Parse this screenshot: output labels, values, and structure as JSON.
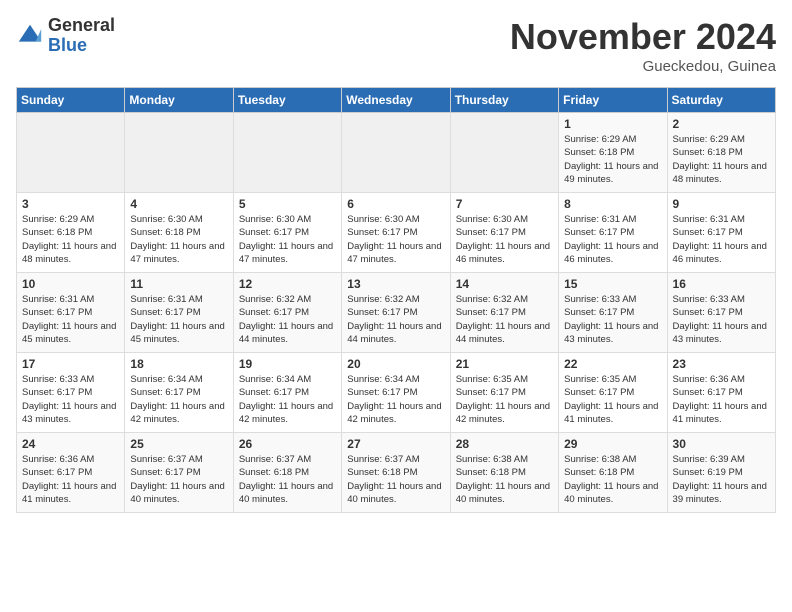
{
  "header": {
    "logo_general": "General",
    "logo_blue": "Blue",
    "month_title": "November 2024",
    "location": "Gueckedou, Guinea"
  },
  "days_of_week": [
    "Sunday",
    "Monday",
    "Tuesday",
    "Wednesday",
    "Thursday",
    "Friday",
    "Saturday"
  ],
  "weeks": [
    [
      {
        "day": "",
        "info": ""
      },
      {
        "day": "",
        "info": ""
      },
      {
        "day": "",
        "info": ""
      },
      {
        "day": "",
        "info": ""
      },
      {
        "day": "",
        "info": ""
      },
      {
        "day": "1",
        "info": "Sunrise: 6:29 AM\nSunset: 6:18 PM\nDaylight: 11 hours and 49 minutes."
      },
      {
        "day": "2",
        "info": "Sunrise: 6:29 AM\nSunset: 6:18 PM\nDaylight: 11 hours and 48 minutes."
      }
    ],
    [
      {
        "day": "3",
        "info": "Sunrise: 6:29 AM\nSunset: 6:18 PM\nDaylight: 11 hours and 48 minutes."
      },
      {
        "day": "4",
        "info": "Sunrise: 6:30 AM\nSunset: 6:18 PM\nDaylight: 11 hours and 47 minutes."
      },
      {
        "day": "5",
        "info": "Sunrise: 6:30 AM\nSunset: 6:17 PM\nDaylight: 11 hours and 47 minutes."
      },
      {
        "day": "6",
        "info": "Sunrise: 6:30 AM\nSunset: 6:17 PM\nDaylight: 11 hours and 47 minutes."
      },
      {
        "day": "7",
        "info": "Sunrise: 6:30 AM\nSunset: 6:17 PM\nDaylight: 11 hours and 46 minutes."
      },
      {
        "day": "8",
        "info": "Sunrise: 6:31 AM\nSunset: 6:17 PM\nDaylight: 11 hours and 46 minutes."
      },
      {
        "day": "9",
        "info": "Sunrise: 6:31 AM\nSunset: 6:17 PM\nDaylight: 11 hours and 46 minutes."
      }
    ],
    [
      {
        "day": "10",
        "info": "Sunrise: 6:31 AM\nSunset: 6:17 PM\nDaylight: 11 hours and 45 minutes."
      },
      {
        "day": "11",
        "info": "Sunrise: 6:31 AM\nSunset: 6:17 PM\nDaylight: 11 hours and 45 minutes."
      },
      {
        "day": "12",
        "info": "Sunrise: 6:32 AM\nSunset: 6:17 PM\nDaylight: 11 hours and 44 minutes."
      },
      {
        "day": "13",
        "info": "Sunrise: 6:32 AM\nSunset: 6:17 PM\nDaylight: 11 hours and 44 minutes."
      },
      {
        "day": "14",
        "info": "Sunrise: 6:32 AM\nSunset: 6:17 PM\nDaylight: 11 hours and 44 minutes."
      },
      {
        "day": "15",
        "info": "Sunrise: 6:33 AM\nSunset: 6:17 PM\nDaylight: 11 hours and 43 minutes."
      },
      {
        "day": "16",
        "info": "Sunrise: 6:33 AM\nSunset: 6:17 PM\nDaylight: 11 hours and 43 minutes."
      }
    ],
    [
      {
        "day": "17",
        "info": "Sunrise: 6:33 AM\nSunset: 6:17 PM\nDaylight: 11 hours and 43 minutes."
      },
      {
        "day": "18",
        "info": "Sunrise: 6:34 AM\nSunset: 6:17 PM\nDaylight: 11 hours and 42 minutes."
      },
      {
        "day": "19",
        "info": "Sunrise: 6:34 AM\nSunset: 6:17 PM\nDaylight: 11 hours and 42 minutes."
      },
      {
        "day": "20",
        "info": "Sunrise: 6:34 AM\nSunset: 6:17 PM\nDaylight: 11 hours and 42 minutes."
      },
      {
        "day": "21",
        "info": "Sunrise: 6:35 AM\nSunset: 6:17 PM\nDaylight: 11 hours and 42 minutes."
      },
      {
        "day": "22",
        "info": "Sunrise: 6:35 AM\nSunset: 6:17 PM\nDaylight: 11 hours and 41 minutes."
      },
      {
        "day": "23",
        "info": "Sunrise: 6:36 AM\nSunset: 6:17 PM\nDaylight: 11 hours and 41 minutes."
      }
    ],
    [
      {
        "day": "24",
        "info": "Sunrise: 6:36 AM\nSunset: 6:17 PM\nDaylight: 11 hours and 41 minutes."
      },
      {
        "day": "25",
        "info": "Sunrise: 6:37 AM\nSunset: 6:17 PM\nDaylight: 11 hours and 40 minutes."
      },
      {
        "day": "26",
        "info": "Sunrise: 6:37 AM\nSunset: 6:18 PM\nDaylight: 11 hours and 40 minutes."
      },
      {
        "day": "27",
        "info": "Sunrise: 6:37 AM\nSunset: 6:18 PM\nDaylight: 11 hours and 40 minutes."
      },
      {
        "day": "28",
        "info": "Sunrise: 6:38 AM\nSunset: 6:18 PM\nDaylight: 11 hours and 40 minutes."
      },
      {
        "day": "29",
        "info": "Sunrise: 6:38 AM\nSunset: 6:18 PM\nDaylight: 11 hours and 40 minutes."
      },
      {
        "day": "30",
        "info": "Sunrise: 6:39 AM\nSunset: 6:19 PM\nDaylight: 11 hours and 39 minutes."
      }
    ]
  ]
}
